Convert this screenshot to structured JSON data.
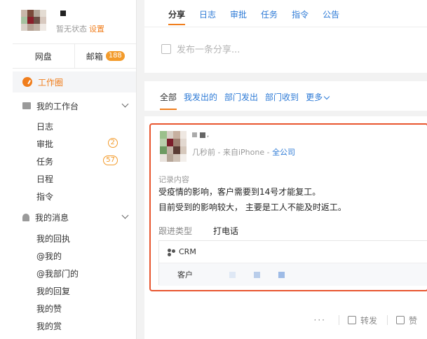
{
  "profile": {
    "status_text": "暂无状态",
    "set_link": "设置"
  },
  "nav_tabs": {
    "disk_label": "网盘",
    "mail_label": "邮箱",
    "mail_count": "188"
  },
  "menu": {
    "active_label": "工作圈",
    "workbench": {
      "label": "我的工作台",
      "items": [
        {
          "label": "日志",
          "count": ""
        },
        {
          "label": "审批",
          "count": "2"
        },
        {
          "label": "任务",
          "count": "57"
        },
        {
          "label": "日程",
          "count": ""
        },
        {
          "label": "指令",
          "count": ""
        }
      ]
    },
    "messages": {
      "label": "我的消息",
      "items": [
        {
          "label": "我的回执"
        },
        {
          "label": "@我的"
        },
        {
          "label": "@我部门的"
        },
        {
          "label": "我的回复"
        },
        {
          "label": "我的赞"
        },
        {
          "label": "我的赏"
        }
      ]
    }
  },
  "share": {
    "tabs": [
      "分享",
      "日志",
      "审批",
      "任务",
      "指令",
      "公告"
    ],
    "compose_placeholder": "发布一条分享..."
  },
  "filters": [
    "全部",
    "我发出的",
    "部门发出",
    "部门收到",
    "更多"
  ],
  "post": {
    "name_suffix": ",",
    "time": "几秒前",
    "source": " - 来自iPhone - ",
    "scope": "全公司",
    "record_label": "记录内容",
    "line1": "受疫情的影响，客户需要到14号才能复工。",
    "line2": "目前受到的影响较大， 主要是工人不能及时返工。",
    "follow_key": "跟进类型",
    "follow_value": "打电话",
    "crm_label": "CRM",
    "customer_key": "客户"
  },
  "actions": {
    "dots": "···",
    "forward": "转发",
    "like": "赞"
  },
  "colors": {
    "accent": "#f07e1d",
    "link": "#2d7ad6",
    "highlight": "#e8552e"
  }
}
